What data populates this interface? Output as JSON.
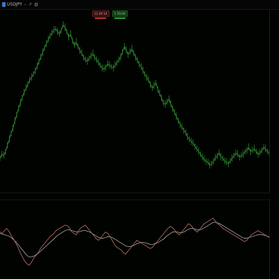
{
  "toolbar": {
    "symbol": "USDJPY",
    "minimize_label": "–",
    "restore_label": "↗",
    "gear_icon": "gear-icon"
  },
  "legend": [
    {
      "label": "12.49 14",
      "color": "#c0392b"
    },
    {
      "label": "1 50.00",
      "color": "#2aa33a"
    }
  ],
  "price_axis_ticks": [
    "",
    "",
    "",
    "",
    "",
    "",
    "",
    "",
    "",
    "",
    "",
    "",
    "",
    "",
    "",
    "",
    "",
    "",
    "",
    ""
  ],
  "osc_axis_ticks": [
    "",
    "",
    "",
    "",
    "",
    ""
  ],
  "time_axis_labels": [
    "",
    "",
    "",
    "",
    "",
    "",
    "",
    "",
    "",
    "",
    "",
    "",
    "",
    "",
    "",
    "",
    "",
    "",
    "",
    "",
    "",
    "",
    "",
    "",
    "",
    ""
  ],
  "axis_marker_label": "",
  "colors": {
    "price_series": "#2f8a2f",
    "oscillator_fast": "#b06a5e",
    "oscillator_slow": "#9a9a9a",
    "background": "#010301"
  },
  "chart_data": {
    "type": "line",
    "price_series": [
      30,
      36,
      34,
      40,
      49,
      58,
      67,
      75,
      85,
      95,
      104,
      112,
      120,
      128,
      134,
      140,
      146,
      150,
      155,
      160,
      166,
      174,
      180,
      187,
      194,
      200,
      206,
      212,
      216,
      220,
      222,
      218,
      214,
      220,
      228,
      224,
      218,
      210,
      214,
      205,
      198,
      202,
      196,
      190,
      186,
      180,
      176,
      174,
      178,
      182,
      185,
      180,
      176,
      172,
      168,
      164,
      162,
      165,
      170,
      168,
      166,
      164,
      168,
      172,
      176,
      180,
      188,
      196,
      190,
      184,
      188,
      192,
      186,
      180,
      175,
      170,
      166,
      160,
      155,
      150,
      146,
      140,
      134,
      138,
      142,
      132,
      126,
      120,
      112,
      110,
      114,
      118,
      110,
      104,
      98,
      92,
      86,
      80,
      76,
      72,
      68,
      62,
      58,
      55,
      52,
      48,
      44,
      40,
      36,
      32,
      28,
      26,
      24,
      20,
      22,
      26,
      30,
      34,
      38,
      32,
      30,
      26,
      24,
      22,
      26,
      30,
      34,
      38,
      36,
      32,
      34,
      36,
      40,
      42,
      46,
      40,
      42,
      44,
      40,
      36,
      38,
      42,
      46,
      44,
      40,
      38
    ],
    "oscillator_fast": [
      60,
      58,
      62,
      65,
      61,
      55,
      50,
      44,
      38,
      30,
      24,
      18,
      14,
      12,
      16,
      22,
      26,
      30,
      36,
      40,
      44,
      48,
      52,
      55,
      58,
      62,
      64,
      66,
      68,
      70,
      69,
      66,
      60,
      58,
      56,
      62,
      66,
      68,
      70,
      66,
      62,
      58,
      54,
      50,
      48,
      52,
      56,
      60,
      58,
      54,
      48,
      42,
      38,
      36,
      34,
      30,
      28,
      32,
      36,
      40,
      44,
      48,
      46,
      44,
      42,
      40,
      38,
      36,
      38,
      42,
      46,
      50,
      54,
      58,
      62,
      66,
      68,
      66,
      62,
      58,
      56,
      60,
      64,
      68,
      72,
      70,
      66,
      62,
      60,
      64,
      68,
      72,
      74,
      76,
      78,
      80,
      76,
      72,
      70,
      66,
      64,
      62,
      60,
      58,
      56,
      54,
      52,
      50,
      48,
      46,
      48,
      52,
      56,
      58,
      60,
      62,
      60,
      58,
      56,
      54,
      52
    ],
    "oscillator_slow": [
      58,
      57,
      56,
      55,
      54,
      52,
      49,
      46,
      42,
      38,
      34,
      30,
      26,
      24,
      24,
      25,
      27,
      29,
      32,
      35,
      38,
      41,
      44,
      47,
      50,
      53,
      56,
      58,
      60,
      62,
      63,
      63,
      62,
      61,
      60,
      60,
      61,
      62,
      62,
      61,
      60,
      58,
      56,
      54,
      52,
      51,
      51,
      52,
      53,
      53,
      52,
      50,
      48,
      46,
      44,
      42,
      40,
      39,
      39,
      40,
      41,
      43,
      44,
      45,
      45,
      44,
      43,
      42,
      42,
      43,
      44,
      46,
      48,
      50,
      53,
      56,
      58,
      60,
      60,
      60,
      59,
      59,
      60,
      62,
      64,
      65,
      65,
      64,
      63,
      63,
      64,
      66,
      68,
      70,
      72,
      74,
      74,
      73,
      72,
      70,
      68,
      66,
      64,
      62,
      60,
      58,
      56,
      54,
      52,
      51,
      51,
      52,
      53,
      54,
      55,
      56,
      56,
      56,
      55,
      54,
      53
    ]
  }
}
